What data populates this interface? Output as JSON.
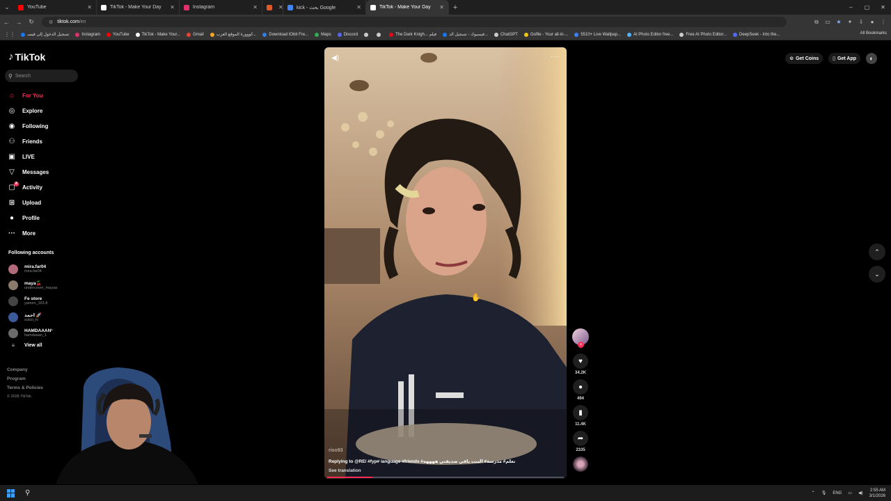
{
  "browser": {
    "tabs": [
      {
        "title": "YouTube",
        "color": "#ff0000",
        "active": false
      },
      {
        "title": "TikTok - Make Your Day",
        "color": "#ffffff",
        "active": false
      },
      {
        "title": "Instagram",
        "color": "#e1306c",
        "active": false
      },
      {
        "title": "",
        "color": "#e0592a",
        "active": false
      },
      {
        "title": "kick - بحث Google",
        "color": "#4285f4",
        "active": false
      },
      {
        "title": "TikTok - Make Your Day",
        "color": "#ffffff",
        "active": true
      }
    ],
    "url_host": "tiktok.com",
    "url_path": "/en",
    "bookmarks": [
      {
        "label": "تسجيل الدخول إلى فيسـ",
        "color": "#1877f2"
      },
      {
        "label": "Instagram",
        "color": "#e1306c"
      },
      {
        "label": "YouTube",
        "color": "#ff0000"
      },
      {
        "label": "TikTok - Make Your...",
        "color": "#ffffff"
      },
      {
        "label": "Gmail",
        "color": "#ea4335"
      },
      {
        "label": "كووورة الموقع العرب...",
        "color": "#f5a623"
      },
      {
        "label": "Download IObit Fre...",
        "color": "#2f7de1"
      },
      {
        "label": "Maps",
        "color": "#34a853"
      },
      {
        "label": "Discord",
        "color": "#5865f2"
      },
      {
        "label": "",
        "color": "#cccccc"
      },
      {
        "label": "",
        "color": "#cccccc"
      },
      {
        "label": "The Dark Knigh... فيلم",
        "color": "#e50914"
      },
      {
        "label": "فيسبوك - تسجيل الد...",
        "color": "#1877f2"
      },
      {
        "label": "ChatGPT",
        "color": "#cccccc"
      },
      {
        "label": "Gofile - Your all-in-...",
        "color": "#f0c419"
      },
      {
        "label": "5510+ Live Wallpap...",
        "color": "#3b82f6"
      },
      {
        "label": "AI Photo Editor free...",
        "color": "#4fb3ff"
      },
      {
        "label": "Free AI Photo Editor...",
        "color": "#cccccc"
      },
      {
        "label": "DeepSeek - Into the...",
        "color": "#4d6bfe"
      }
    ],
    "all_bookmarks": "All Bookmarks"
  },
  "sidebar": {
    "logo": "TikTok",
    "search_placeholder": "Search",
    "nav": [
      {
        "label": "For You",
        "icon": "home-icon",
        "glyph": "⌂",
        "active": true
      },
      {
        "label": "Explore",
        "icon": "compass-icon",
        "glyph": "◎",
        "active": false
      },
      {
        "label": "Following",
        "icon": "following-icon",
        "glyph": "◉",
        "active": false
      },
      {
        "label": "Friends",
        "icon": "friends-icon",
        "glyph": "⚇",
        "active": false
      },
      {
        "label": "LIVE",
        "icon": "live-icon",
        "glyph": "▣",
        "active": false
      },
      {
        "label": "Messages",
        "icon": "messages-icon",
        "glyph": "▽",
        "active": false
      },
      {
        "label": "Activity",
        "icon": "activity-icon",
        "glyph": "▢",
        "active": false,
        "badge": "8"
      },
      {
        "label": "Upload",
        "icon": "upload-icon",
        "glyph": "⊞",
        "active": false
      },
      {
        "label": "Profile",
        "icon": "profile-icon",
        "glyph": "●",
        "active": false
      },
      {
        "label": "More",
        "icon": "more-icon",
        "glyph": "···",
        "active": false
      }
    ],
    "following_header": "Following accounts",
    "following": [
      {
        "display": "mira.far04",
        "username": "mira.far04",
        "color": "#b06a7a"
      },
      {
        "display": "maya🍒",
        "username": "undercover_mayaa",
        "color": "#8a7a6a"
      },
      {
        "display": "Fe store",
        "username": "yamen_163.8",
        "color": "#444444"
      },
      {
        "display": "احمد 🚀",
        "username": "subzi_tv",
        "color": "#3a5a9a"
      },
      {
        "display": "HAMDAAAN¹",
        "username": "hamdaaan_1",
        "color": "#6a6a6a"
      }
    ],
    "view_all": "View all",
    "footer": [
      "Company",
      "Program",
      "Terms & Policies"
    ],
    "copyright": "© 2026 TikTok"
  },
  "video": {
    "username": "riso93",
    "description": "Replying to @RE/ #fyp# language #friends #تعلم# مدرسة# البنت باقي صديقتي ههههه",
    "see_translation": "See translation",
    "progress": 0.19
  },
  "actions": {
    "likes": "34.2K",
    "comments": "494",
    "saves": "11.4K",
    "shares": "2335"
  },
  "topbar": {
    "get_coins": "Get Coins",
    "get_app": "Get App"
  },
  "taskbar": {
    "lang": "ENG",
    "time": "2:55 AM",
    "date": "3/1/2026"
  }
}
